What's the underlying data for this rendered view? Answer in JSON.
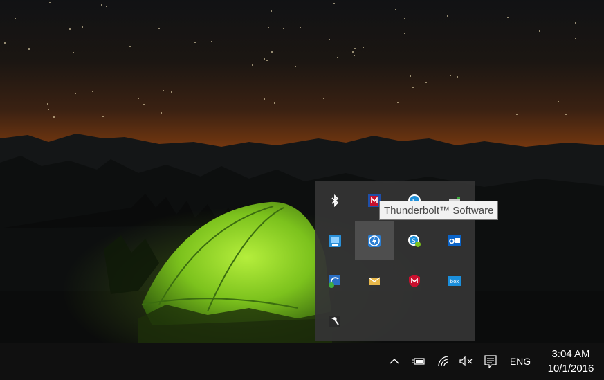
{
  "tooltip": {
    "text": "Thunderbolt™ Software"
  },
  "tray_icons": [
    {
      "name": "bluetooth-icon",
      "row": 0,
      "col": 0
    },
    {
      "name": "mcafee-security-icon",
      "row": 0,
      "col": 1
    },
    {
      "name": "skype-icon",
      "row": 0,
      "col": 2
    },
    {
      "name": "disk-drive-icon",
      "row": 0,
      "col": 3
    },
    {
      "name": "network-utility-icon",
      "row": 1,
      "col": 0
    },
    {
      "name": "thunderbolt-icon",
      "row": 1,
      "col": 1,
      "hover": true
    },
    {
      "name": "skype-business-icon",
      "row": 1,
      "col": 2
    },
    {
      "name": "outlook-icon",
      "row": 1,
      "col": 3
    },
    {
      "name": "sync-tool-icon",
      "row": 2,
      "col": 0
    },
    {
      "name": "mail-icon",
      "row": 2,
      "col": 1
    },
    {
      "name": "mcafee-shield-icon",
      "row": 2,
      "col": 2
    },
    {
      "name": "box-sync-icon",
      "row": 2,
      "col": 3
    },
    {
      "name": "hammer-tool-icon",
      "row": 3,
      "col": 0
    }
  ],
  "taskbar": {
    "language": "ENG",
    "time": "3:04 AM",
    "date": "10/1/2016"
  },
  "colors": {
    "flyout_bg": "#343434",
    "taskbar_bg": "#101010",
    "tooltip_bg": "#f2f2f2"
  }
}
